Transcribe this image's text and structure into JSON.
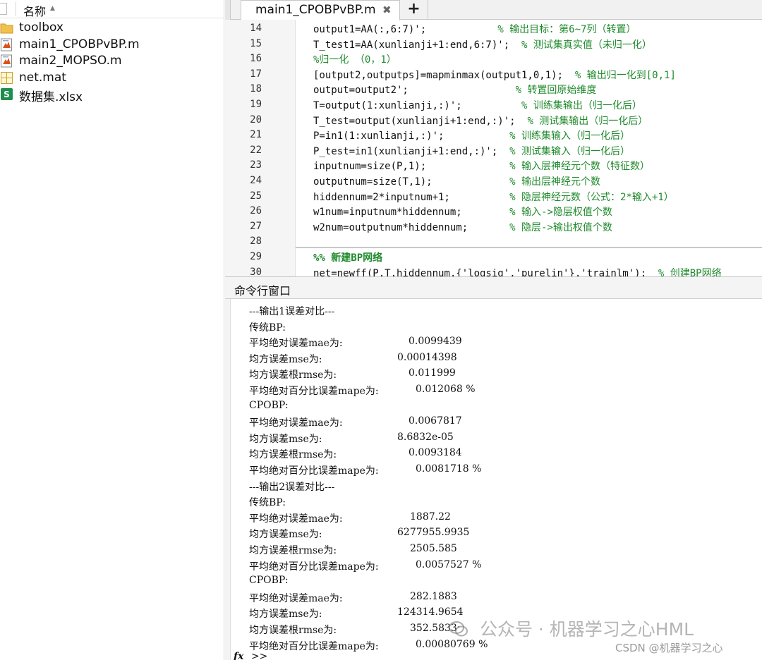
{
  "file_browser": {
    "header_label": "名称",
    "sort_indicator": "▲",
    "items": [
      {
        "name": "toolbox",
        "icon": "folder-icon"
      },
      {
        "name": "main1_CPOBPvBP.m",
        "icon": "matlab-script-icon"
      },
      {
        "name": "main2_MOPSO.m",
        "icon": "matlab-script-icon"
      },
      {
        "name": "net.mat",
        "icon": "mat-file-icon"
      },
      {
        "name": "数据集.xlsx",
        "icon": "excel-file-icon"
      }
    ]
  },
  "editor": {
    "tab_label": "main1_CPOBPvBP.m",
    "tab_close": "✖",
    "tab_add": "+",
    "lines": [
      {
        "num": "14",
        "code": "output1=AA(:,6:7)';",
        "pad": "            ",
        "comment": "% 输出目标：第6~7列（转置）"
      },
      {
        "num": "15",
        "code": "T_test1=AA(xunlianji+1:end,6:7)';",
        "pad": "  ",
        "comment": "% 测试集真实值（未归一化）"
      },
      {
        "num": "16",
        "code": "",
        "pad": "",
        "comment": "%归一化 （0，1）"
      },
      {
        "num": "17",
        "code": "[output2,outputps]=mapminmax(output1,0,1);",
        "pad": "  ",
        "comment": "% 输出归一化到[0,1]"
      },
      {
        "num": "18",
        "code": "output=output2';",
        "pad": "                  ",
        "comment": "% 转置回原始维度"
      },
      {
        "num": "19",
        "code": "T=output(1:xunlianji,:)';",
        "pad": "          ",
        "comment": "% 训练集输出（归一化后）"
      },
      {
        "num": "20",
        "code": "T_test=output(xunlianji+1:end,:)';",
        "pad": "  ",
        "comment": "% 测试集输出（归一化后）"
      },
      {
        "num": "21",
        "code": "P=in1(1:xunlianji,:)';",
        "pad": "           ",
        "comment": "% 训练集输入（归一化后）"
      },
      {
        "num": "22",
        "code": "P_test=in1(xunlianji+1:end,:)';",
        "pad": "  ",
        "comment": "% 测试集输入（归一化后）"
      },
      {
        "num": "23",
        "code": "inputnum=size(P,1);",
        "pad": "              ",
        "comment": "% 输入层神经元个数（特征数）"
      },
      {
        "num": "24",
        "code": "outputnum=size(T,1);",
        "pad": "             ",
        "comment": "% 输出层神经元个数"
      },
      {
        "num": "25",
        "code": "hiddennum=2*inputnum+1;",
        "pad": "          ",
        "comment": "% 隐层神经元数（公式：2*输入+1）"
      },
      {
        "num": "26",
        "code": "w1num=inputnum*hiddennum;",
        "pad": "        ",
        "comment": "% 输入->隐层权值个数"
      },
      {
        "num": "27",
        "code": "w2num=outputnum*hiddennum;",
        "pad": "       ",
        "comment": "% 隐层->输出权值个数"
      },
      {
        "num": "28",
        "code": "",
        "pad": "",
        "comment": ""
      },
      {
        "num": "29",
        "code": "",
        "pad": "",
        "comment": "%% 新建BP网络"
      },
      {
        "num": "30",
        "code": "net=newff(P,T,hiddennum,{'logsig','purelin'},'trainlm');",
        "pad": "  ",
        "comment": "% 创建BP网络"
      }
    ]
  },
  "command_window": {
    "title": "命令行窗口",
    "prompt": ">>",
    "prompt_icon": "fx",
    "output": [
      {
        "label": "---输出1误差对比---",
        "value": ""
      },
      {
        "label": "传统BP:",
        "value": ""
      },
      {
        "label": "平均绝对误差mae为:",
        "value": "0.0099439"
      },
      {
        "label": "均方误差mse为:",
        "value": "0.00014398"
      },
      {
        "label": "均方误差根rmse为:",
        "value": "0.011999"
      },
      {
        "label": "平均绝对百分比误差mape为:",
        "value": "0.012068 %"
      },
      {
        "label": "CPOBP:",
        "value": ""
      },
      {
        "label": "平均绝对误差mae为:",
        "value": "0.0067817"
      },
      {
        "label": "均方误差mse为:",
        "value": "8.6832e-05"
      },
      {
        "label": "均方误差根rmse为:",
        "value": "0.0093184"
      },
      {
        "label": "平均绝对百分比误差mape为:",
        "value": "0.0081718 %"
      },
      {
        "label": "---输出2误差对比---",
        "value": ""
      },
      {
        "label": "传统BP:",
        "value": ""
      },
      {
        "label": "平均绝对误差mae为:",
        "value": "1887.22"
      },
      {
        "label": "均方误差mse为:",
        "value": "6277955.9935"
      },
      {
        "label": "均方误差根rmse为:",
        "value": "2505.585"
      },
      {
        "label": "平均绝对百分比误差mape为:",
        "value": "0.0057527 %"
      },
      {
        "label": "CPOBP:",
        "value": ""
      },
      {
        "label": "平均绝对误差mae为:",
        "value": "282.1883"
      },
      {
        "label": "均方误差mse为:",
        "value": "124314.9654"
      },
      {
        "label": "均方误差根rmse为:",
        "value": "352.5833"
      },
      {
        "label": "平均绝对百分比误差mape为:",
        "value": "0.00080769 %"
      }
    ]
  },
  "watermark": {
    "main": "公众号 · 机器学习之心HML",
    "csdn": "CSDN @机器学习之心"
  }
}
